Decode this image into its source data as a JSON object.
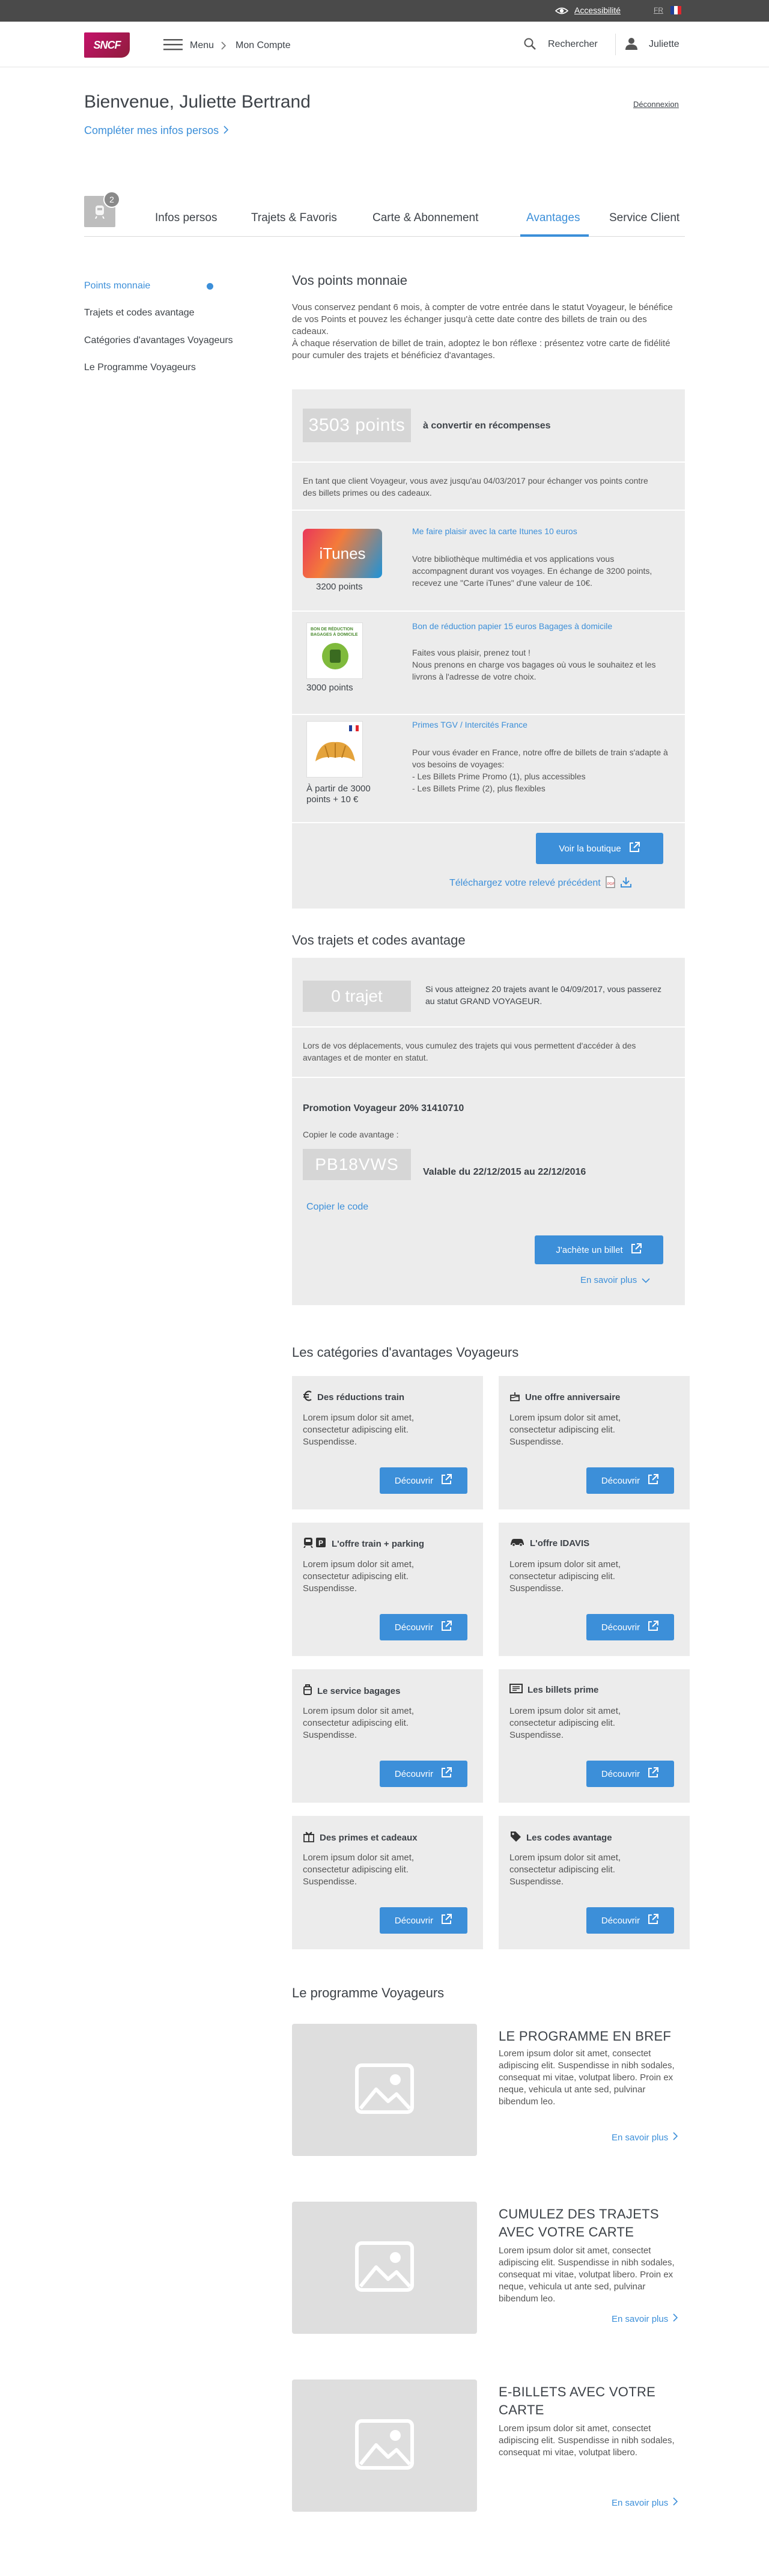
{
  "topbar": {
    "accessibility_label": "Accessibilité",
    "lang": "FR"
  },
  "header": {
    "logo": "SNCF",
    "menu_label": "Menu",
    "breadcrumb": "Mon Compte",
    "search_label": "Rechercher",
    "user_name": "Juliette"
  },
  "welcome": {
    "title": "Bienvenue, Juliette Bertrand",
    "complete_link": "Compléter mes infos persos",
    "logout": "Déconnexion"
  },
  "tabs": {
    "badge": "2",
    "items": [
      "Infos persos",
      "Trajets & Favoris",
      "Carte & Abonnement",
      "Avantages",
      "Service Client"
    ],
    "active": "Avantages"
  },
  "sidenav": {
    "items": [
      "Points monnaie",
      "Trajets et codes avantage",
      "Catégories d'avantages Voyageurs",
      "Le Programme Voyageurs"
    ]
  },
  "points": {
    "title": "Vos points monnaie",
    "intro": "Vous conservez pendant 6 mois, à compter de votre entrée dans le statut Voyageur, le bénéfice de vos Points et pouvez les échanger jusqu'à cette date contre des billets de train ou des cadeaux.",
    "intro2": "À chaque réservation de billet de train, adoptez le bon réflexe : présentez votre carte de fidélité pour cumuler des trajets et bénéficiez d'avantages.",
    "balance": "3503 points",
    "balance_label": "à convertir en récompenses",
    "note": "En tant que client Voyageur, vous avez jusqu'au 04/03/2017 pour échanger vos points contre des billets primes ou des cadeaux.",
    "offers": [
      {
        "image_label": "iTunes",
        "cost": "3200 points",
        "link": "Me faire plaisir avec la carte Itunes 10 euros",
        "desc": "Votre bibliothèque multimédia et vos applications vous accompagnent durant vos voyages. En échange de 3200 points, recevez une \"Carte iTunes\" d'une valeur de 10€."
      },
      {
        "image_label": "BON DE RÉDUCTION BAGAGES À DOMICILE",
        "cost": "3000 points",
        "link": "Bon de réduction papier 15 euros Bagages à domicile",
        "desc": "Faites vous plaisir, prenez tout !",
        "desc2": "Nous prenons en charge vos bagages où vous le souhaitez et les livrons à l'adresse de votre choix."
      },
      {
        "cost": "À partir de 3000 points  + 10 €",
        "link": "Primes TGV / Intercités France",
        "desc": "Pour vous évader en France, notre offre de billets de train s'adapte à vos besoins de voyages:",
        "desc2": "- Les Billets Prime Promo (1), plus accessibles",
        "desc3": "- Les Billets Prime (2), plus flexibles"
      }
    ],
    "shop_button": "Voir la boutique",
    "download_link": "Téléchargez votre relevé précédent"
  },
  "trips": {
    "title": "Vos trajets et codes avantage",
    "count": "0 trajet",
    "count_note": "Si vous atteignez 20 trajets avant le 04/09/2017, vous passerez au statut GRAND VOYAGEUR.",
    "info": "Lors de vos déplacements, vous cumulez des trajets qui vous permettent d'accéder à des avantages et de monter en statut.",
    "promo_title": "Promotion Voyageur 20% 31410710",
    "copy_label": "Copier le code avantage :",
    "code": "PB18VWS",
    "validity": "Valable du 22/12/2015 au 22/12/2016",
    "copy_link": "Copier le code",
    "buy_button": "J'achète un billet",
    "more": "En savoir plus"
  },
  "categories": {
    "title": "Les catégories d'avantages Voyageurs",
    "items": [
      {
        "title": "Des réductions train",
        "desc": "Lorem ipsum dolor sit amet, consectetur adipiscing elit. Suspendisse.",
        "button": "Découvrir",
        "icon": "euro-icon"
      },
      {
        "title": "Une offre anniversaire",
        "desc": "Lorem ipsum dolor sit amet, consectetur adipiscing elit. Suspendisse.",
        "button": "Découvrir",
        "icon": "cake-icon"
      },
      {
        "title": "L'offre train + parking",
        "desc": "Lorem ipsum dolor sit amet, consectetur adipiscing elit. Suspendisse.",
        "button": "Découvrir",
        "icon": "train-parking-icon"
      },
      {
        "title": "L'offre IDAVIS",
        "desc": "Lorem ipsum dolor sit amet, consectetur adipiscing elit. Suspendisse.",
        "button": "Découvrir",
        "icon": "car-icon"
      },
      {
        "title": "Le service bagages",
        "desc": "Lorem ipsum dolor sit amet, consectetur adipiscing elit. Suspendisse.",
        "button": "Découvrir",
        "icon": "luggage-icon"
      },
      {
        "title": "Les billets prime",
        "desc": "Lorem ipsum dolor sit amet, consectetur adipiscing elit. Suspendisse.",
        "button": "Découvrir",
        "icon": "ticket-icon"
      },
      {
        "title": "Des primes et cadeaux",
        "desc": "Lorem ipsum dolor sit amet, consectetur adipiscing elit. Suspendisse.",
        "button": "Découvrir",
        "icon": "gift-icon"
      },
      {
        "title": "Les codes avantage",
        "desc": "Lorem ipsum dolor sit amet, consectetur adipiscing elit. Suspendisse.",
        "button": "Découvrir",
        "icon": "tag-icon"
      }
    ]
  },
  "program": {
    "title": "Le programme Voyageurs",
    "items": [
      {
        "title_line1": "LE PROGRAMME EN BREF",
        "title_line2": "",
        "desc": "Lorem ipsum dolor sit amet, consectet adipiscing elit. Suspendisse in nibh sodales, consequat mi vitae, volutpat libero. Proin ex neque, vehicula ut ante sed, pulvinar bibendum leo.",
        "more": "En savoir plus"
      },
      {
        "title_line1": "CUMULEZ DES TRAJETS",
        "title_line2": "AVEC VOTRE CARTE",
        "desc": "Lorem ipsum dolor sit amet, consectet adipiscing elit. Suspendisse in nibh sodales, consequat mi vitae, volutpat libero. Proin ex neque, vehicula ut ante sed, pulvinar bibendum leo.",
        "more": "En savoir plus"
      },
      {
        "title_line1": "E-BILLETS AVEC VOTRE",
        "title_line2": "CARTE",
        "desc": "Lorem ipsum dolor sit amet, consectet adipiscing elit. Suspendisse in nibh sodales, consequat mi vitae, volutpat libero.",
        "more": "En savoir plus"
      }
    ]
  },
  "colors": {
    "accent": "#3c8fd9",
    "brand": "#b0125b",
    "topbar": "#4a4a4a",
    "panel": "#ececec"
  }
}
